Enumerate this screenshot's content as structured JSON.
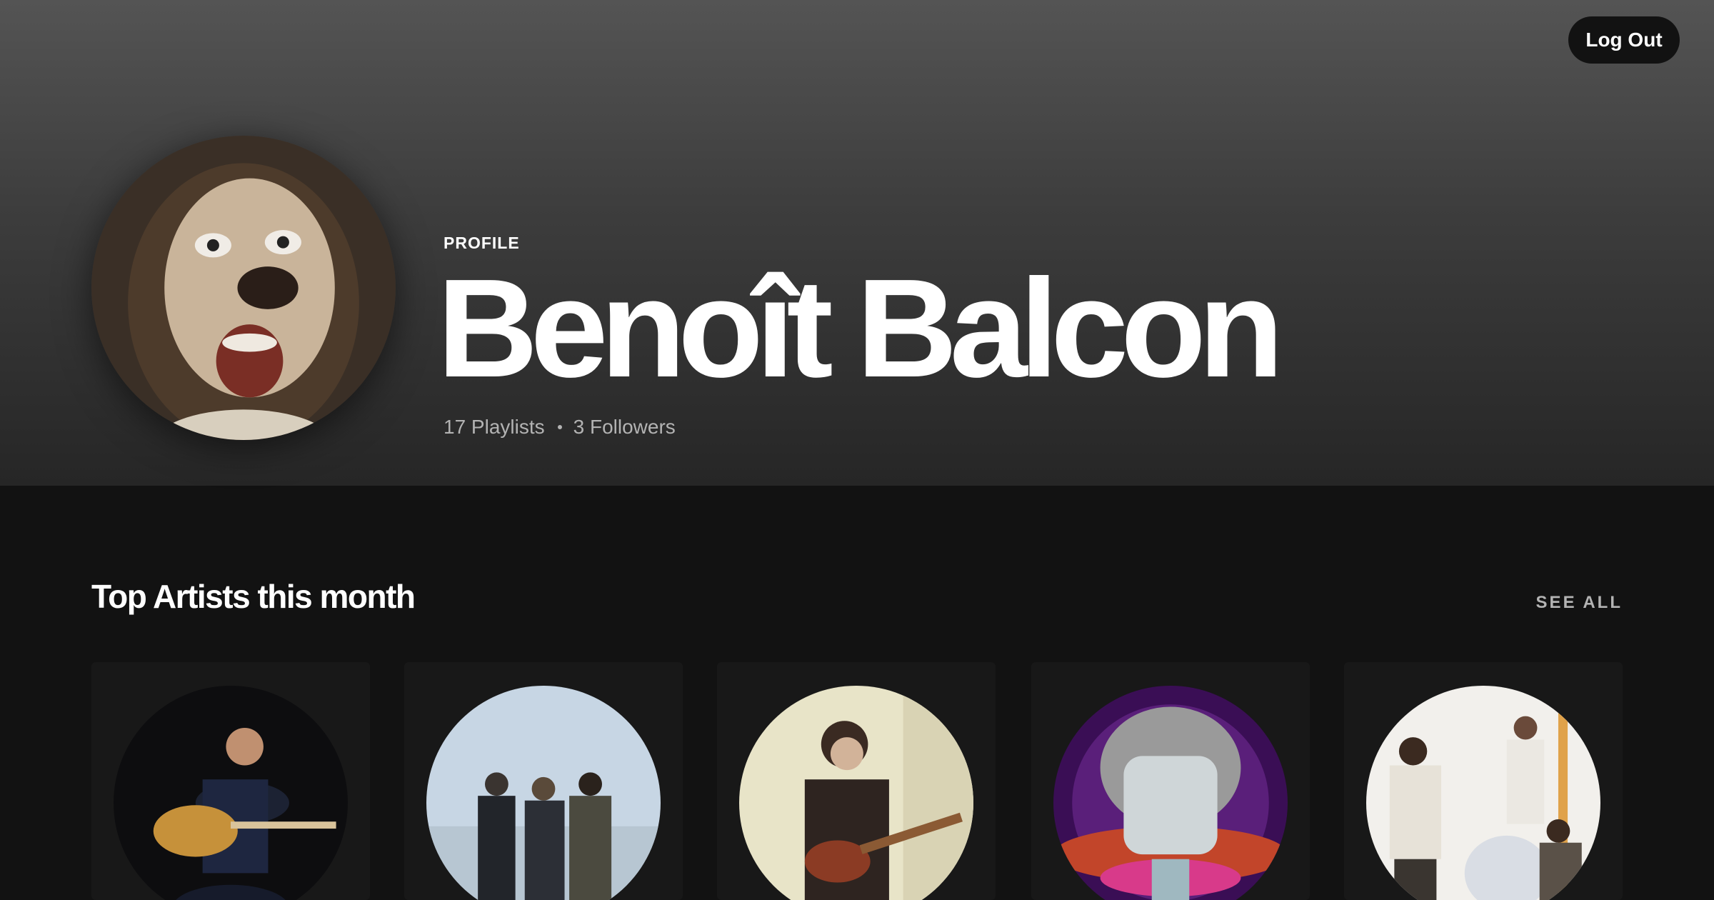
{
  "header": {
    "logout_label": "Log Out"
  },
  "profile": {
    "label": "PROFILE",
    "name": "Benoît Balcon",
    "playlists": "17 Playlists",
    "followers": "3 Followers"
  },
  "top_artists": {
    "title": "Top Artists this month",
    "see_all_label": "SEE ALL",
    "items": [
      {
        "image": "artist-guitarist-photo"
      },
      {
        "image": "artist-band-trio-photo"
      },
      {
        "image": "artist-ukulele-player-photo"
      },
      {
        "image": "artist-illustrated-portrait"
      },
      {
        "image": "artist-band-indoor-photo"
      }
    ]
  },
  "colors": {
    "background": "#121212",
    "card": "#181818",
    "text_primary": "#ffffff",
    "text_secondary": "#b3b3b3"
  }
}
